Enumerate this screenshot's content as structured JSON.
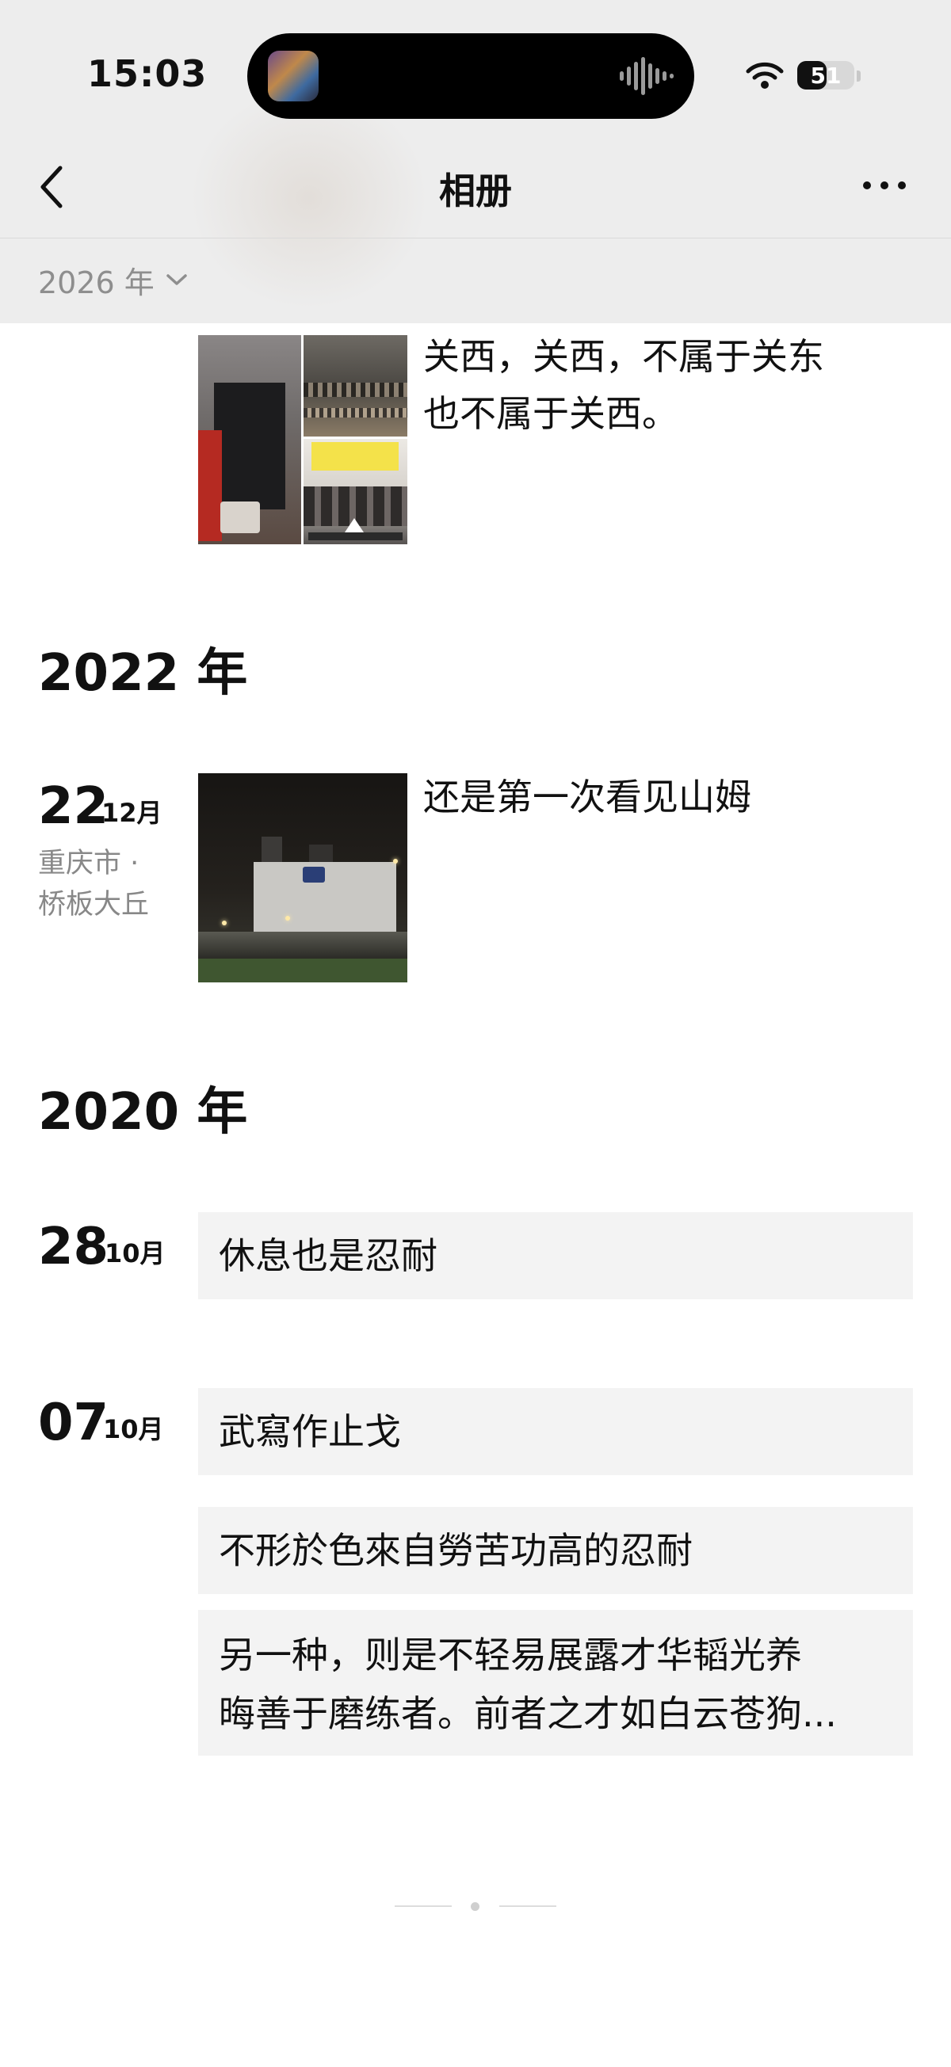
{
  "status_bar": {
    "time": "15:03",
    "battery_level": "51",
    "icons": [
      "now-playing-artwork",
      "audio-waveform-icon",
      "wifi-icon",
      "battery-icon"
    ]
  },
  "nav": {
    "title": "相册",
    "back_icon": "chevron-left-icon",
    "more_icon": "more-dots-icon"
  },
  "year_filter": {
    "label": "2026 年",
    "icon": "chevron-down-icon"
  },
  "feed": {
    "post_top": {
      "text_line1": "关西，关西，不属于关东",
      "text_line2": "也不属于关西。",
      "photos": 3
    },
    "year_2022": "2022 年",
    "post_2022_12_22": {
      "day": "22",
      "month": "12月",
      "location_line1": "重庆市 ·",
      "location_line2": "桥板大丘",
      "text": "还是第一次看见山姆",
      "photos": 1
    },
    "year_2020": "2020 年",
    "post_2020_10_28": {
      "day": "28",
      "month": "10月",
      "text": "休息也是忍耐"
    },
    "post_2020_10_07": {
      "day": "07",
      "month": "10月",
      "entries": [
        "武寫作止戈",
        "不形於色來自勞苦功高的忍耐"
      ],
      "long_entry_line1": "另一种，则是不轻易展露才华韬光养",
      "long_entry_line2": "晦善于磨练者。前者之才如白云苍狗..."
    }
  },
  "colors": {
    "header_bg": "#ededed",
    "card_bg": "#f3f3f3",
    "muted_text": "#888888"
  }
}
